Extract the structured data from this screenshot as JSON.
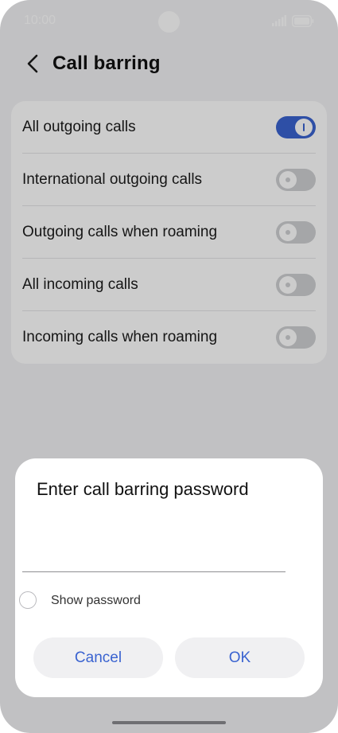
{
  "status_bar": {
    "time": "10:00"
  },
  "header": {
    "title": "Call barring"
  },
  "settings": [
    {
      "label": "All outgoing calls",
      "enabled": true
    },
    {
      "label": "International outgoing calls",
      "enabled": false
    },
    {
      "label": "Outgoing calls when roaming",
      "enabled": false
    },
    {
      "label": "All incoming calls",
      "enabled": false
    },
    {
      "label": "Incoming calls when roaming",
      "enabled": false
    }
  ],
  "dialog": {
    "title": "Enter call barring password",
    "password_value": "",
    "show_password_label": "Show password",
    "cancel_label": "Cancel",
    "ok_label": "OK"
  },
  "colors": {
    "accent": "#3a63d0",
    "toggle_off": "#cfd0d3",
    "background": "#f2f2f4"
  }
}
